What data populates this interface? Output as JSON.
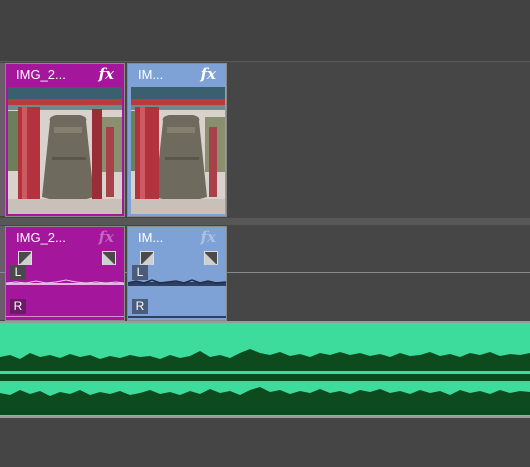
{
  "video_track": {
    "clips": [
      {
        "name": "IMG_2...",
        "fx_label": "fx",
        "color": "#a4169c"
      },
      {
        "name": "IM...",
        "fx_label": "fx",
        "color": "#7ea2d6"
      }
    ]
  },
  "audio_track": {
    "clips": [
      {
        "name": "IMG_2...",
        "fx_label": "fx",
        "color": "#a4169c",
        "left_channel": "L",
        "right_channel": "R"
      },
      {
        "name": "IM...",
        "fx_label": "fx",
        "color": "#7ea2d6",
        "left_channel": "L",
        "right_channel": "R"
      }
    ]
  },
  "music_track": {
    "color": "#3ddc9c",
    "wave_color": "#0d4a1e"
  },
  "icons": {
    "fade_in": "fade-in-handle-icon",
    "fade_out": "fade-out-handle-icon",
    "effects": "fx-icon"
  }
}
